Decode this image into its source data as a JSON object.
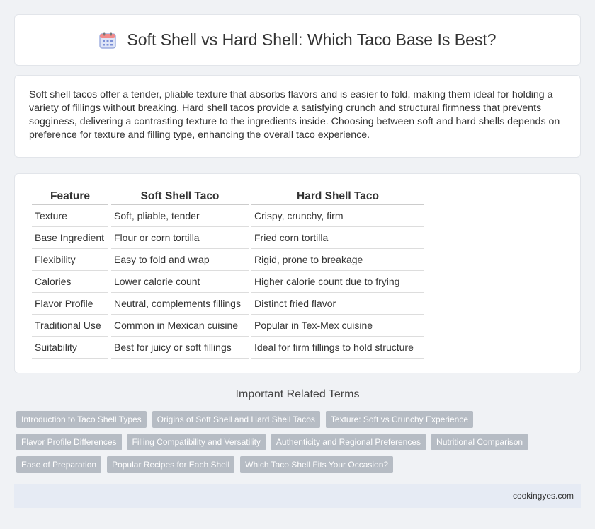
{
  "header": {
    "title": "Soft Shell vs Hard Shell: Which Taco Base Is Best?",
    "icon": "calendar-icon"
  },
  "intro": {
    "text": "Soft shell tacos offer a tender, pliable texture that absorbs flavors and is easier to fold, making them ideal for holding a variety of fillings without breaking. Hard shell tacos provide a satisfying crunch and structural firmness that prevents sogginess, delivering a contrasting texture to the ingredients inside. Choosing between soft and hard shells depends on preference for texture and filling type, enhancing the overall taco experience."
  },
  "table": {
    "headers": [
      "Feature",
      "Soft Shell Taco",
      "Hard Shell Taco"
    ],
    "rows": [
      [
        "Texture",
        "Soft, pliable, tender",
        "Crispy, crunchy, firm"
      ],
      [
        "Base Ingredient",
        "Flour or corn tortilla",
        "Fried corn tortilla"
      ],
      [
        "Flexibility",
        "Easy to fold and wrap",
        "Rigid, prone to breakage"
      ],
      [
        "Calories",
        "Lower calorie count",
        "Higher calorie count due to frying"
      ],
      [
        "Flavor Profile",
        "Neutral, complements fillings",
        "Distinct fried flavor"
      ],
      [
        "Traditional Use",
        "Common in Mexican cuisine",
        "Popular in Tex-Mex cuisine"
      ],
      [
        "Suitability",
        "Best for juicy or soft fillings",
        "Ideal for firm fillings to hold structure"
      ]
    ]
  },
  "related": {
    "title": "Important Related Terms",
    "rows": [
      [
        "Introduction to Taco Shell Types",
        "Origins of Soft Shell and Hard Shell Tacos",
        "Texture: Soft vs Crunchy Experience"
      ],
      [
        "Flavor Profile Differences",
        "Filling Compatibility and Versatility",
        "Authenticity and Regional Preferences",
        "Nutritional Comparison"
      ],
      [
        "Ease of Preparation",
        "Popular Recipes for Each Shell",
        "Which Taco Shell Fits Your Occasion?"
      ]
    ]
  },
  "footer": {
    "site": "cookingyes.com"
  },
  "colors": {
    "background": "#f0f2f5",
    "tag": "#b6bcc4",
    "footer": "#e6ebf4",
    "icon_accent": "#7b8fd6"
  }
}
